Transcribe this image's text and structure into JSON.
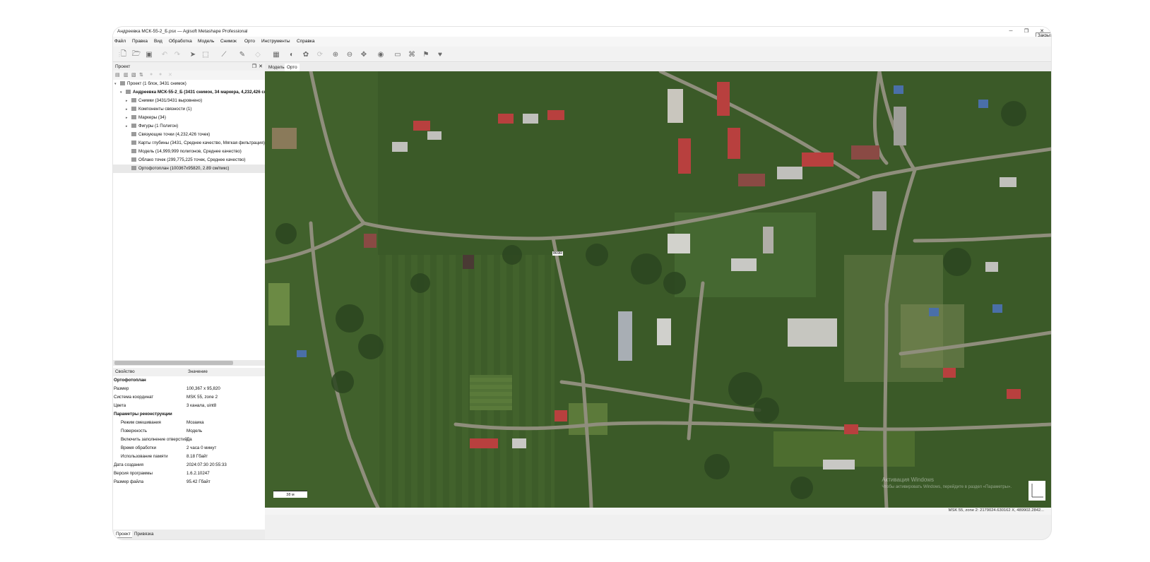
{
  "window": {
    "title": "Андреевка МСК-55-2_Б.psx — Agisoft Metashape Professional",
    "close_tooltip": "Закрыть"
  },
  "menu": {
    "items": [
      "Файл",
      "Правка",
      "Вид",
      "Обработка",
      "Модель",
      "Снимок",
      "Орто",
      "Инструменты",
      "Справка"
    ]
  },
  "project_panel": {
    "title": "Проект",
    "tree": [
      {
        "label": "Проект (1 блок, 3431 снимок)",
        "indent": 0,
        "expanded": true
      },
      {
        "label": "Андреевка МСК-55-2_Б (3431 снимок, 34 маркера, 4,232,426 связующих точек)",
        "indent": 1,
        "expanded": true,
        "bold": true
      },
      {
        "label": "Снимки (3431/3431 выровнено)",
        "indent": 2,
        "collapsed": true
      },
      {
        "label": "Компоненты связности (1)",
        "indent": 2,
        "collapsed": true
      },
      {
        "label": "Маркеры (34)",
        "indent": 2,
        "collapsed": true
      },
      {
        "label": "Фигуры (1 Полигон)",
        "indent": 2,
        "collapsed": true
      },
      {
        "label": "Связующие точки (4,232,426 точек)",
        "indent": 2
      },
      {
        "label": "Карты глубины (3431, Среднее качество, Мягкая фильтрация)",
        "indent": 2
      },
      {
        "label": "Модель (14,999,999 полигонов, Среднее качество)",
        "indent": 2
      },
      {
        "label": "Облако точек (299,775,225 точек, Среднее качество)",
        "indent": 2
      },
      {
        "label": "Ортофотоплан (100367x95820, 2.89 см/пикс)",
        "indent": 2,
        "selected": true
      }
    ]
  },
  "properties": {
    "col_property": "Свойство",
    "col_value": "Значение",
    "rows": [
      {
        "key": "Ортофотоплан",
        "value": "",
        "bold": true,
        "indent": false
      },
      {
        "key": "Размер",
        "value": "100,367 x 95,820",
        "indent": false
      },
      {
        "key": "Система координат",
        "value": "MSK 55, zone 2",
        "indent": false
      },
      {
        "key": "Цвета",
        "value": "3 канала, uint8",
        "indent": false
      },
      {
        "key": "Параметры реконструкции",
        "value": "",
        "bold": true,
        "indent": false
      },
      {
        "key": "Режим смешивания",
        "value": "Мозаика",
        "indent": true
      },
      {
        "key": "Поверхность",
        "value": "Модель",
        "indent": true
      },
      {
        "key": "Включить заполнение отверстий",
        "value": "Да",
        "indent": true
      },
      {
        "key": "Время обработки",
        "value": "2 часа 0 минут",
        "indent": true
      },
      {
        "key": "Использование памяти",
        "value": "8.18 Гбайт",
        "indent": true
      },
      {
        "key": "Дата создания",
        "value": "2024:07:30 20:55:33",
        "indent": false
      },
      {
        "key": "Версия программы",
        "value": "1.6.2.10247",
        "indent": false
      },
      {
        "key": "Размер файла",
        "value": "95.42 Гбайт",
        "indent": false
      }
    ]
  },
  "bottom_tabs": [
    "Проект",
    "Привязка"
  ],
  "view_tabs": [
    "Модель",
    "Орто"
  ],
  "map": {
    "scale_label": "38 м",
    "marker_label": "869R",
    "watermark_line1": "Активация Windows",
    "watermark_line2": "Чтобы активировать Windows, перейдите в раздел «Параметры»."
  },
  "status": {
    "text": "MSK 55, zone 2: 2179024.630162 X, 489902.2842..."
  },
  "icons": {
    "toolbar": [
      "new-icon",
      "open-icon",
      "save-icon",
      "undo-icon",
      "redo-icon",
      "navigate-icon",
      "select-rect-icon",
      "draw-polyline-icon",
      "ruler-icon",
      "shape-icon",
      "ortho-icon",
      "shading-icon",
      "palette-icon",
      "refresh-icon",
      "zoom-in-icon",
      "zoom-out-icon",
      "move-icon",
      "globe-icon",
      "image-icon",
      "camera-icon",
      "flag-icon",
      "heart-icon"
    ]
  },
  "colors": {
    "map_green": "#3c5a2a",
    "road": "#9c9a86",
    "roof_red": "#b8403e",
    "roof_blue": "#4a6fa8"
  }
}
